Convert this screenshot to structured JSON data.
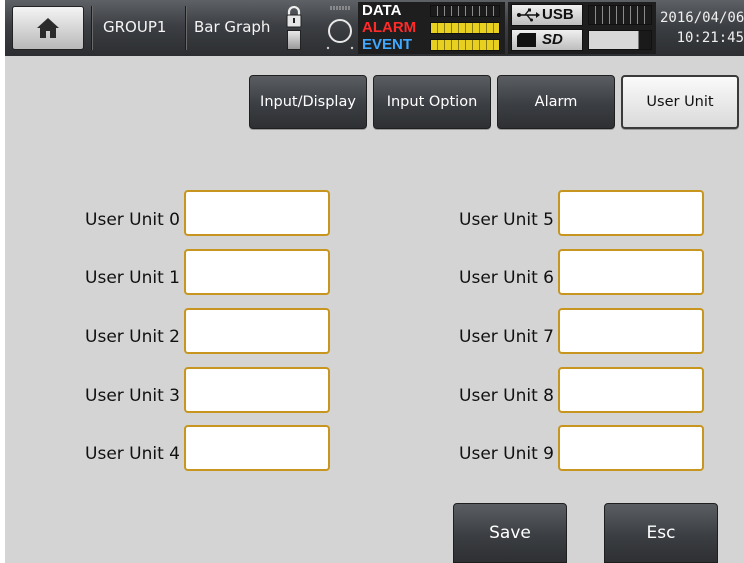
{
  "statusbar": {
    "group": "GROUP1",
    "display_mode": "Bar Graph",
    "data_label": "DATA",
    "alarm_label": "ALARM",
    "event_label": "EVENT",
    "usb_label": "USB",
    "sd_label": "SD",
    "date": "2016/04/06",
    "time": "10:21:45",
    "colors": {
      "data": "#ffffff",
      "alarm": "#ff2a2a",
      "event": "#3fa8ff",
      "meter_fill": "#e8d020"
    }
  },
  "icons": {
    "home": "home-icon",
    "lock": "lock-icon",
    "ring": "ring-icon",
    "usb": "usb-icon",
    "sd": "sd-card-icon"
  },
  "tabs": [
    {
      "label": "Input/Display",
      "active": false
    },
    {
      "label": "Input Option",
      "active": false
    },
    {
      "label": "Alarm",
      "active": false
    },
    {
      "label": "User Unit",
      "active": true
    }
  ],
  "fields": {
    "left": [
      {
        "label": "User Unit 0",
        "value": ""
      },
      {
        "label": "User Unit 1",
        "value": ""
      },
      {
        "label": "User Unit 2",
        "value": ""
      },
      {
        "label": "User Unit 3",
        "value": ""
      },
      {
        "label": "User Unit 4",
        "value": ""
      }
    ],
    "right": [
      {
        "label": "User Unit 5",
        "value": ""
      },
      {
        "label": "User Unit 6",
        "value": ""
      },
      {
        "label": "User Unit 7",
        "value": ""
      },
      {
        "label": "User Unit 8",
        "value": ""
      },
      {
        "label": "User Unit 9",
        "value": ""
      }
    ]
  },
  "buttons": {
    "save_label": "Save",
    "esc_label": "Esc"
  },
  "colors": {
    "background": "#d4d4d4",
    "field_border": "#c8961e",
    "button_dark": "#3b3e42"
  }
}
